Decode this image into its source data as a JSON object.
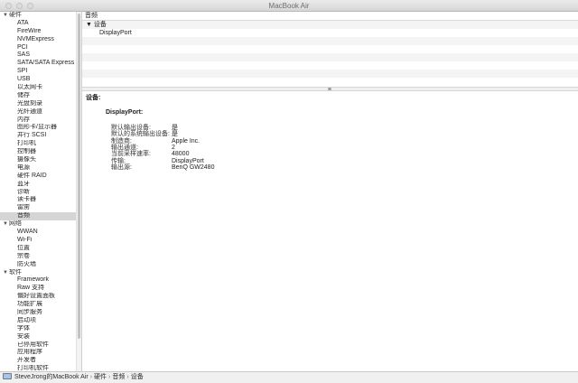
{
  "window": {
    "title": "MacBook Air"
  },
  "sidebar": {
    "categories": [
      {
        "label": "硬件",
        "items": [
          "ATA",
          "FireWire",
          "NVMExpress",
          "PCI",
          "SAS",
          "SATA/SATA Express",
          "SPI",
          "USB",
          "以太网卡",
          "储存",
          "光盘刻录",
          "光纤通道",
          "内存",
          "图形卡/显示器",
          "并行 SCSI",
          "打印机",
          "控制器",
          "摄像头",
          "电源",
          "硬件 RAID",
          "蓝牙",
          "诊断",
          "读卡器",
          "雷雳",
          "音频"
        ]
      },
      {
        "label": "网络",
        "items": [
          "WWAN",
          "Wi-Fi",
          "位置",
          "宗卷",
          "防火墙"
        ]
      },
      {
        "label": "软件",
        "items": [
          "Framework",
          "Raw 支持",
          "偏好设置面板",
          "功能扩展",
          "同步服务",
          "启动项",
          "字体",
          "安装",
          "已停用软件",
          "应用程序",
          "开发者",
          "打印机软件"
        ]
      }
    ],
    "selected": "音频"
  },
  "main": {
    "column_header": "音频",
    "tree": {
      "parent": "设备",
      "child": "DisplayPort"
    },
    "detail": {
      "heading": "设备:",
      "device": "DisplayPort:",
      "properties": [
        {
          "key": "默认输出设备:",
          "value": "是"
        },
        {
          "key": "默认的系统输出设备:",
          "value": "是"
        },
        {
          "key": "制造商:",
          "value": "Apple Inc."
        },
        {
          "key": "输出通道:",
          "value": "2"
        },
        {
          "key": "当前采样速率:",
          "value": "48000"
        },
        {
          "key": "传输:",
          "value": "DisplayPort"
        },
        {
          "key": "输出源:",
          "value": "BenQ GW2480"
        }
      ]
    }
  },
  "statusbar": {
    "path": [
      "SteveJrong的MacBook Air",
      "硬件",
      "音频",
      "设备"
    ],
    "separator": "›"
  }
}
